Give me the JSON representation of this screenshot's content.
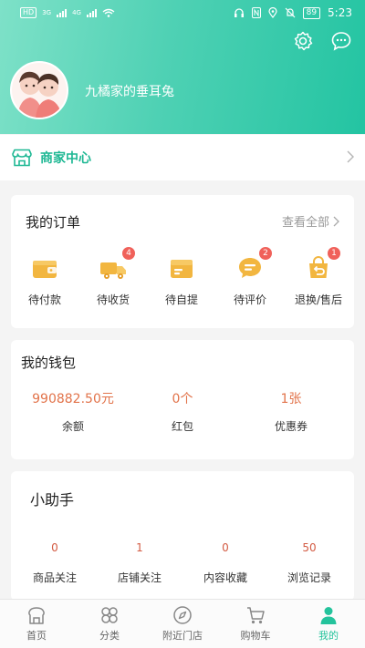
{
  "status_bar": {
    "hd": "HD",
    "net1": "3G",
    "net2": "4G",
    "battery": "89",
    "time": "5:23"
  },
  "header": {
    "settings_icon": "gear-icon",
    "message_icon": "chat-bubble-icon",
    "username": "九橘家的垂耳兔"
  },
  "merchant": {
    "label": "商家中心",
    "icon": "storefront-icon"
  },
  "orders": {
    "title": "我的订单",
    "view_all": "查看全部",
    "items": [
      {
        "label": "待付款",
        "icon": "wallet-icon",
        "badge": ""
      },
      {
        "label": "待收货",
        "icon": "truck-icon",
        "badge": "4"
      },
      {
        "label": "待自提",
        "icon": "box-icon",
        "badge": ""
      },
      {
        "label": "待评价",
        "icon": "comment-icon",
        "badge": "2"
      },
      {
        "label": "退换/售后",
        "icon": "return-bag-icon",
        "badge": "1"
      }
    ]
  },
  "wallet": {
    "title": "我的钱包",
    "items": [
      {
        "value": "990882.50元",
        "label": "余额"
      },
      {
        "value": "0个",
        "label": "红包"
      },
      {
        "value": "1张",
        "label": "优惠券"
      }
    ]
  },
  "helper": {
    "title": "小助手",
    "items": [
      {
        "value": "0",
        "label": "商品关注"
      },
      {
        "value": "1",
        "label": "店铺关注"
      },
      {
        "value": "0",
        "label": "内容收藏"
      },
      {
        "value": "50",
        "label": "浏览记录"
      }
    ]
  },
  "tabbar": {
    "items": [
      {
        "label": "首页",
        "icon": "home-icon"
      },
      {
        "label": "分类",
        "icon": "category-icon"
      },
      {
        "label": "附近门店",
        "icon": "compass-icon"
      },
      {
        "label": "购物车",
        "icon": "cart-icon"
      },
      {
        "label": "我的",
        "icon": "person-icon"
      }
    ],
    "active_index": 4
  },
  "colors": {
    "brand": "#24c39c",
    "accent_orange": "#f2b640",
    "badge": "#f0615a",
    "value_text": "#e2734a"
  }
}
